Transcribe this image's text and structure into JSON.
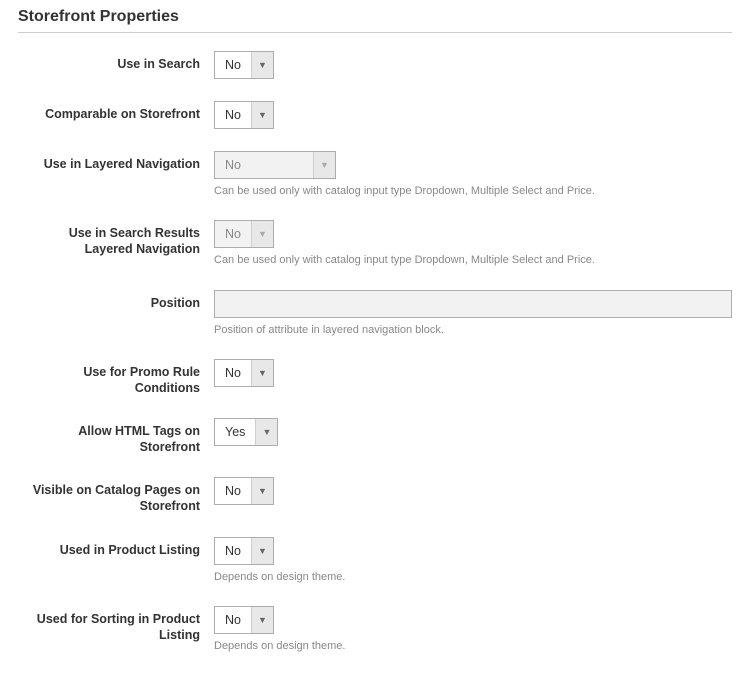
{
  "section": {
    "title": "Storefront Properties"
  },
  "fields": {
    "use_in_search": {
      "label": "Use in Search",
      "value": "No"
    },
    "comparable": {
      "label": "Comparable on Storefront",
      "value": "No"
    },
    "layered_nav": {
      "label": "Use in Layered Navigation",
      "value": "No",
      "help": "Can be used only with catalog input type Dropdown, Multiple Select and Price."
    },
    "search_layered_nav": {
      "label": "Use in Search Results Layered Navigation",
      "value": "No",
      "help": "Can be used only with catalog input type Dropdown, Multiple Select and Price."
    },
    "position": {
      "label": "Position",
      "value": "",
      "help": "Position of attribute in layered navigation block."
    },
    "promo_rule": {
      "label": "Use for Promo Rule Conditions",
      "value": "No"
    },
    "allow_html": {
      "label": "Allow HTML Tags on Storefront",
      "value": "Yes"
    },
    "visible_catalog": {
      "label": "Visible on Catalog Pages on Storefront",
      "value": "No"
    },
    "product_listing": {
      "label": "Used in Product Listing",
      "value": "No",
      "help": "Depends on design theme."
    },
    "sorting_listing": {
      "label": "Used for Sorting in Product Listing",
      "value": "No",
      "help": "Depends on design theme."
    }
  }
}
